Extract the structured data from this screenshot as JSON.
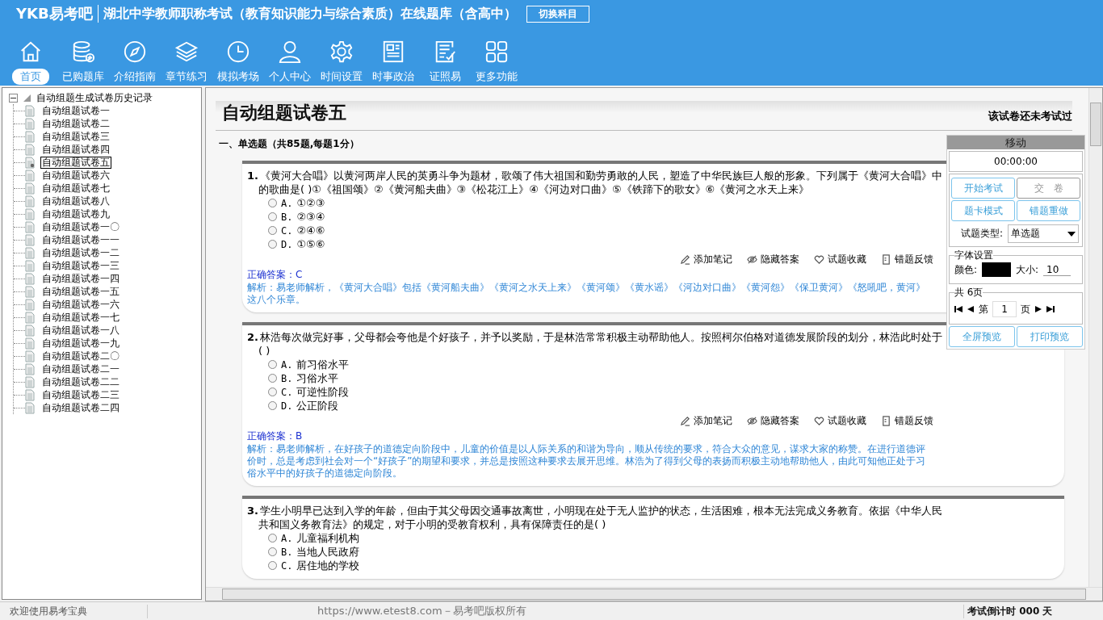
{
  "app": {
    "logo": "YKB易考吧",
    "title": "湖北中学教师职称考试（教育知识能力与综合素质）在线题库（含高中）",
    "switch_button": "切换科目"
  },
  "nav": [
    {
      "label": "首页",
      "kind": "home",
      "selected": true
    },
    {
      "label": "已购题库",
      "kind": "database",
      "selected": false
    },
    {
      "label": "介绍指南",
      "kind": "compass",
      "selected": false
    },
    {
      "label": "章节练习",
      "kind": "layers",
      "selected": false
    },
    {
      "label": "模拟考场",
      "kind": "clock",
      "selected": false
    },
    {
      "label": "个人中心",
      "kind": "person",
      "selected": false
    },
    {
      "label": "时间设置",
      "kind": "gear",
      "selected": false
    },
    {
      "label": "时事政治",
      "kind": "newspaper",
      "selected": false
    },
    {
      "label": "证照易",
      "kind": "checklist",
      "selected": false
    },
    {
      "label": "更多功能",
      "kind": "grid",
      "selected": false
    }
  ],
  "tree": {
    "label": "自动组题生成试卷历史记录",
    "expanded": true,
    "children": [
      {
        "label": "自动组题试卷一",
        "selected": false
      },
      {
        "label": "自动组题试卷二",
        "selected": false
      },
      {
        "label": "自动组题试卷三",
        "selected": false
      },
      {
        "label": "自动组题试卷四",
        "selected": false
      },
      {
        "label": "自动组题试卷五",
        "selected": true
      },
      {
        "label": "自动组题试卷六",
        "selected": false
      },
      {
        "label": "自动组题试卷七",
        "selected": false
      },
      {
        "label": "自动组题试卷八",
        "selected": false
      },
      {
        "label": "自动组题试卷九",
        "selected": false
      },
      {
        "label": "自动组题试卷一〇",
        "selected": false
      },
      {
        "label": "自动组题试卷一一",
        "selected": false
      },
      {
        "label": "自动组题试卷一二",
        "selected": false
      },
      {
        "label": "自动组题试卷一三",
        "selected": false
      },
      {
        "label": "自动组题试卷一四",
        "selected": false
      },
      {
        "label": "自动组题试卷一五",
        "selected": false
      },
      {
        "label": "自动组题试卷一六",
        "selected": false
      },
      {
        "label": "自动组题试卷一七",
        "selected": false
      },
      {
        "label": "自动组题试卷一八",
        "selected": false
      },
      {
        "label": "自动组题试卷一九",
        "selected": false
      },
      {
        "label": "自动组题试卷二〇",
        "selected": false
      },
      {
        "label": "自动组题试卷二一",
        "selected": false
      },
      {
        "label": "自动组题试卷二二",
        "selected": false
      },
      {
        "label": "自动组题试卷二三",
        "selected": false
      },
      {
        "label": "自动组题试卷二四",
        "selected": false
      }
    ]
  },
  "paper": {
    "title": "自动组题试卷五",
    "status": "该试卷还未考试过",
    "section": "一、单选题（共85题,每题1分）",
    "questions": [
      {
        "number": "1.",
        "text": "《黄河大合唱》以黄河两岸人民的英勇斗争为题材，歌颂了伟大祖国和勤劳勇敢的人民，塑造了中华民族巨人般的形象。下列属于《黄河大合唱》中的歌曲是( )①《祖国颂》②《黄河船夫曲》③《松花江上》④《河边对口曲》⑤《铁蹄下的歌女》⑥《黄河之水天上来》",
        "options": [
          {
            "letter": "A.",
            "text": "①②③",
            "selected": false
          },
          {
            "letter": "B.",
            "text": "②③④",
            "selected": false
          },
          {
            "letter": "C.",
            "text": "②④⑥",
            "selected": false
          },
          {
            "letter": "D.",
            "text": "①⑤⑥",
            "selected": false
          }
        ],
        "actions": [
          "添加笔记",
          "隐藏答案",
          "试题收藏",
          "错题反馈"
        ],
        "answer": "正确答案：C",
        "analysis": "解析：易老师解析，《黄河大合唱》包括《黄河船夫曲》《黄河之水天上来》《黄河颂》《黄水谣》《河边对口曲》《黄河怨》《保卫黄河》《怒吼吧，黄河》这八个乐章。"
      },
      {
        "number": "2.",
        "text": "林浩每次做完好事，父母都会夸他是个好孩子，并予以奖励，于是林浩常常积极主动帮助他人。按照柯尔伯格对道德发展阶段的划分，林浩此时处于( )",
        "options": [
          {
            "letter": "A.",
            "text": "前习俗水平",
            "selected": false
          },
          {
            "letter": "B.",
            "text": "习俗水平",
            "selected": false
          },
          {
            "letter": "C.",
            "text": "可逆性阶段",
            "selected": false
          },
          {
            "letter": "D.",
            "text": "公正阶段",
            "selected": false
          }
        ],
        "actions": [
          "添加笔记",
          "隐藏答案",
          "试题收藏",
          "错题反馈"
        ],
        "answer": "正确答案：B",
        "analysis": "解析：易老师解析，在好孩子的道德定向阶段中，儿童的价值是以人际关系的和谐为导向，顺从传统的要求，符合大众的意见，谋求大家的称赞。在进行道德评价时，总是考虑到社会对一个“好孩子”的期望和要求，并总是按照这种要求去展开思维。林浩为了得到父母的表扬而积极主动地帮助他人，由此可知他正处于习俗水平中的好孩子的道德定向阶段。"
      },
      {
        "number": "3.",
        "text": "学生小明早已达到入学的年龄，但由于其父母因交通事故离世，小明现在处于无人监护的状态，生活困难，根本无法完成义务教育。依据《中华人民共和国义务教育法》的规定，对于小明的受教育权利，具有保障责任的是( )",
        "options": [
          {
            "letter": "A.",
            "text": "儿童福利机构",
            "selected": false
          },
          {
            "letter": "B.",
            "text": "当地人民政府",
            "selected": false
          },
          {
            "letter": "C.",
            "text": "居住地的学校",
            "selected": false
          }
        ]
      }
    ]
  },
  "panel": {
    "header": "移动",
    "timer": "00:00:00",
    "buttons": [
      {
        "label": "开始考试",
        "disabled": false
      },
      {
        "label": "交　卷",
        "disabled": true
      },
      {
        "label": "题卡模式",
        "disabled": false
      },
      {
        "label": "错题重做",
        "disabled": false
      }
    ],
    "type_label": "试题类型:",
    "type_value": "单选题",
    "font_group": "字体设置",
    "color_label": "颜色:",
    "size_label": "大小:",
    "size_value": "10",
    "pages_group": "共 6页",
    "page_prefix": "第",
    "page_value": "1",
    "page_suffix": "页",
    "bottom_buttons": [
      "全屏预览",
      "打印预览"
    ]
  },
  "status_bar": {
    "welcome": "欢迎使用易考宝典",
    "copyright": "https://www.etest8.com－易考吧版权所有",
    "countdown": "考试倒计时 000 天"
  }
}
